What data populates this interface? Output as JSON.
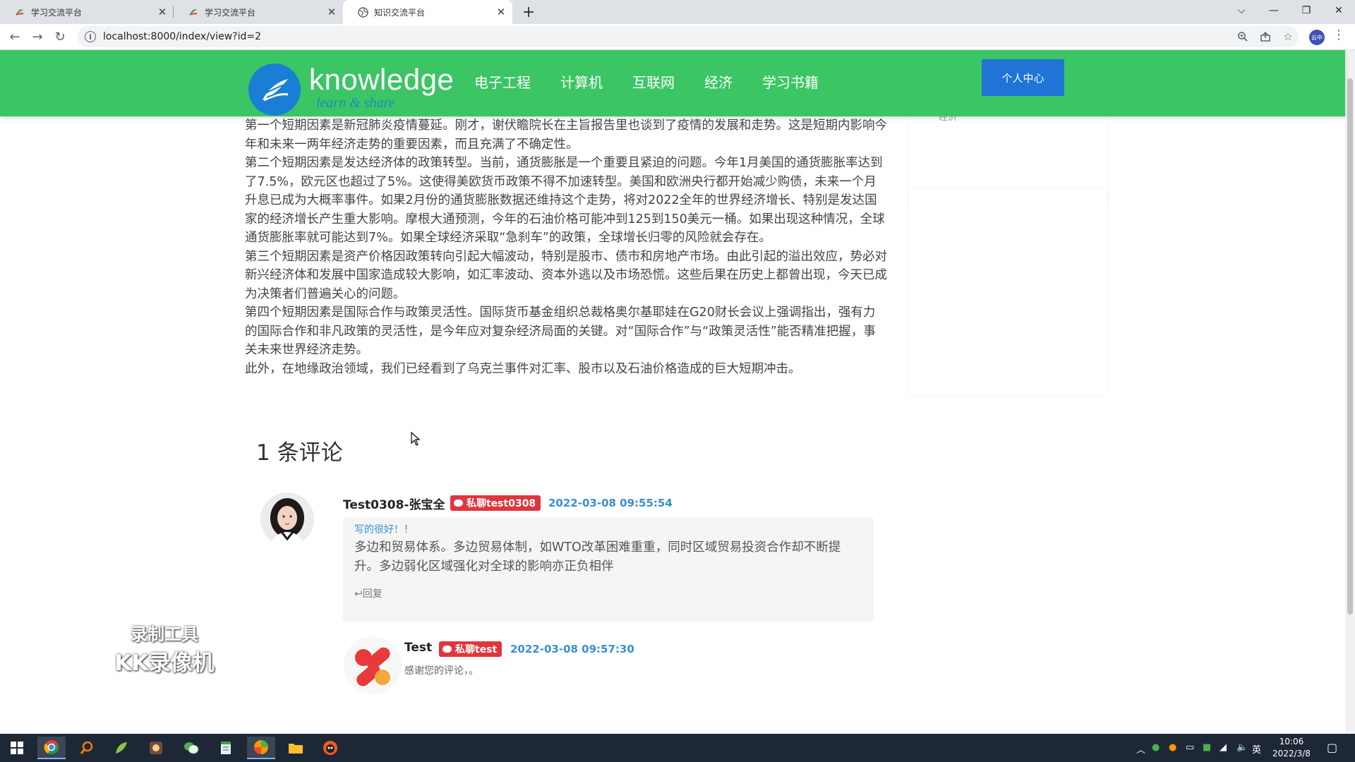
{
  "browser": {
    "tabs": [
      {
        "title": "学习交流平台",
        "active": false
      },
      {
        "title": "学习交流平台",
        "active": false
      },
      {
        "title": "知识交流平台",
        "active": true
      }
    ],
    "url": "localhost:8000/index/view?id=2",
    "profile_label": "云中"
  },
  "site": {
    "logo_text": "knowledge",
    "logo_sub": "learn & share",
    "menu": [
      "电子工程",
      "计算机",
      "互联网",
      "经济",
      "学习书籍"
    ],
    "user_center": "个人中心",
    "side_fragment": "经济"
  },
  "article": {
    "paragraphs": [
      "第一个短期因素是新冠肺炎疫情蔓延。刚才，谢伏瞻院长在主旨报告里也谈到了疫情的发展和走势。这是短期内影响今年和未来一两年经济走势的重要因素，而且充满了不确定性。",
      "第二个短期因素是发达经济体的政策转型。当前，通货膨胀是一个重要且紧迫的问题。今年1月美国的通货膨胀率达到了7.5%，欧元区也超过了5%。这使得美欧货币政策不得不加速转型。美国和欧洲央行都开始减少购债，未来一个月升息已成为大概率事件。如果2月份的通货膨胀数据还维持这个走势，将对2022全年的世界经济增长、特别是发达国家的经济增长产生重大影响。摩根大通预测，今年的石油价格可能冲到125到150美元一桶。如果出现这种情况，全球通货膨胀率就可能达到7%。如果全球经济采取“急刹车”的政策，全球增长归零的风险就会存在。",
      "第三个短期因素是资产价格因政策转向引起大幅波动，特别是股市、债市和房地产市场。由此引起的溢出效应，势必对新兴经济体和发展中国家造成较大影响，如汇率波动、资本外逃以及市场恐慌。这些后果在历史上都曾出现，今天已成为决策者们普遍关心的问题。",
      "第四个短期因素是国际合作与政策灵活性。国际货币基金组织总裁格奥尔基耶娃在G20财长会议上强调指出，强有力的国际合作和非凡政策的灵活性，是今年应对复杂经济局面的关键。对“国际合作”与“政策灵活性”能否精准把握，事关未来世界经济走势。",
      "此外，在地缘政治领域，我们已经看到了乌克兰事件对汇率、股市以及石油价格造成的巨大短期冲击。"
    ]
  },
  "comments": {
    "title": "1 条评论",
    "items": [
      {
        "name": "Test0308-张宝全",
        "pm_label": "私聊test0308",
        "time": "2022-03-08 09:55:54",
        "quote": "写的很好！！",
        "text": "多边和贸易体系。多边贸易体制，如WTO改革困难重重，同时区域贸易投资合作却不断提升。多边弱化区域强化对全球的影响亦正负相伴",
        "reply_label": "回复"
      }
    ],
    "reply": {
      "name": "Test",
      "pm_label": "私聊test",
      "time": "2022-03-08 09:57:30",
      "text": "感谢您的评论，。"
    }
  },
  "watermark": {
    "line1": "录制工具",
    "line2": "KK录像机"
  },
  "taskbar": {
    "time": "10:06",
    "date": "2022/3/8",
    "ime": "英"
  },
  "colors": {
    "header_green": "#3cc564",
    "logo_blue": "#1a7fd4",
    "button_blue": "#1f74d6",
    "badge_red": "#e0353d",
    "time_blue": "#3a8fd0"
  }
}
